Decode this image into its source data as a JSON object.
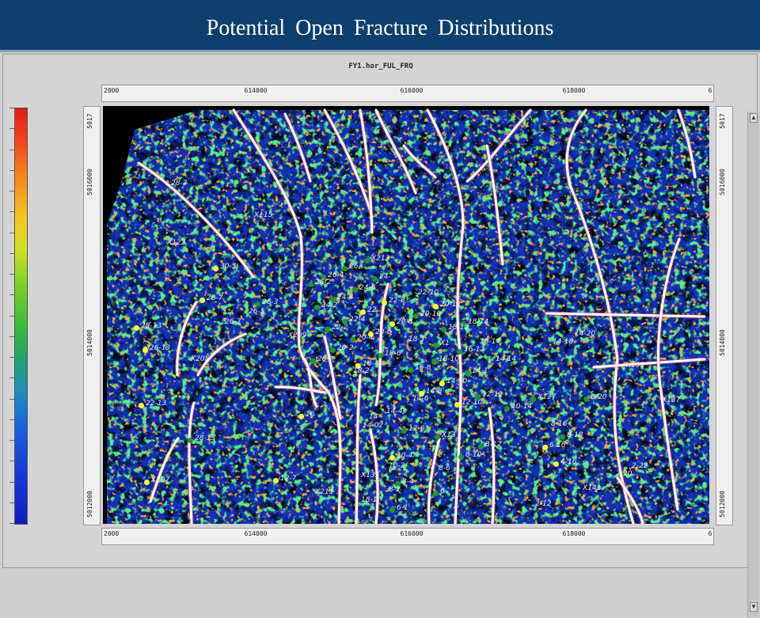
{
  "slide_title": "Potential  Open  Fracture  Distributions",
  "map_title": "FY1.hor_FUL_FRQ",
  "colors": {
    "title_bg": "#0d3f6e",
    "background": "#0a1a9a",
    "yellow_well": "#ffff33",
    "green_well": "#1f9a2a",
    "fracture": "#ffffff"
  },
  "axes": {
    "x_ticks": [
      "2000",
      "614000",
      "616000",
      "618000",
      "6"
    ],
    "y_ticks": [
      "5017",
      "5016000",
      "5014000",
      "5012000"
    ]
  },
  "wells": [
    {
      "label": "X115",
      "color": "none",
      "x": 185,
      "y": 140
    },
    {
      "label": "28-7",
      "color": "none",
      "x": 80,
      "y": 100
    },
    {
      "label": "X122",
      "color": "none",
      "x": 75,
      "y": 175
    },
    {
      "label": "30-5",
      "color": "yellow",
      "x": 142,
      "y": 205
    },
    {
      "label": "28-7",
      "color": "yellow",
      "x": 125,
      "y": 245
    },
    {
      "label": "26-3",
      "color": "green",
      "x": 195,
      "y": 250
    },
    {
      "label": "26-5",
      "color": "none",
      "x": 178,
      "y": 262
    },
    {
      "label": "26-7",
      "color": "none",
      "x": 148,
      "y": 275
    },
    {
      "label": "28-13",
      "color": "yellow",
      "x": 42,
      "y": 280
    },
    {
      "label": "26-13",
      "color": "yellow",
      "x": 53,
      "y": 308
    },
    {
      "label": "X209",
      "color": "none",
      "x": 228,
      "y": 292
    },
    {
      "label": "X205",
      "color": "none",
      "x": 105,
      "y": 322
    },
    {
      "label": "22-13",
      "color": "yellow",
      "x": 48,
      "y": 378
    },
    {
      "label": "20-",
      "color": "green",
      "x": 265,
      "y": 322
    },
    {
      "label": "16",
      "color": "yellow",
      "x": 250,
      "y": 392
    },
    {
      "label": "28-13",
      "color": "green",
      "x": 110,
      "y": 422
    },
    {
      "label": "X207",
      "color": "yellow",
      "x": 55,
      "y": 475
    },
    {
      "label": "12-7",
      "color": "yellow",
      "x": 218,
      "y": 473
    },
    {
      "label": "X211",
      "color": "none",
      "x": 262,
      "y": 490
    },
    {
      "label": "X213",
      "color": "green",
      "x": 333,
      "y": 195
    },
    {
      "label": "26-",
      "color": "green",
      "x": 305,
      "y": 205
    },
    {
      "label": "24-",
      "color": "green",
      "x": 343,
      "y": 218
    },
    {
      "label": "26-4",
      "color": "green",
      "x": 278,
      "y": 216
    },
    {
      "label": "26-2",
      "color": "green",
      "x": 262,
      "y": 225
    },
    {
      "label": "24-6",
      "color": "green",
      "x": 318,
      "y": 232
    },
    {
      "label": "24-4",
      "color": "green",
      "x": 290,
      "y": 244
    },
    {
      "label": "22-8",
      "color": "yellow",
      "x": 355,
      "y": 248
    },
    {
      "label": "24-2",
      "color": "green",
      "x": 270,
      "y": 254
    },
    {
      "label": "22-",
      "color": "yellow",
      "x": 328,
      "y": 260
    },
    {
      "label": "22-4",
      "color": "green",
      "x": 305,
      "y": 272
    },
    {
      "label": "22-2",
      "color": "green",
      "x": 283,
      "y": 282
    },
    {
      "label": "20-6",
      "color": "yellow",
      "x": 338,
      "y": 288
    },
    {
      "label": "20-4",
      "color": "green",
      "x": 315,
      "y": 295
    },
    {
      "label": "22-10",
      "color": "none",
      "x": 392,
      "y": 238
    },
    {
      "label": "20-12",
      "color": "yellow",
      "x": 420,
      "y": 253
    },
    {
      "label": "20-10",
      "color": "green",
      "x": 395,
      "y": 265
    },
    {
      "label": "20-8",
      "color": "yellow",
      "x": 365,
      "y": 275
    },
    {
      "label": "18-14",
      "color": "green",
      "x": 455,
      "y": 275
    },
    {
      "label": "18-15",
      "color": "green",
      "x": 430,
      "y": 282
    },
    {
      "label": "18-3",
      "color": "none",
      "x": 380,
      "y": 297
    },
    {
      "label": "X1",
      "color": "green",
      "x": 420,
      "y": 302
    },
    {
      "label": "16-14",
      "color": "none",
      "x": 470,
      "y": 300
    },
    {
      "label": "16-12",
      "color": "green",
      "x": 450,
      "y": 310
    },
    {
      "label": "20-2",
      "color": "green",
      "x": 290,
      "y": 308
    },
    {
      "label": "18-6",
      "color": "green",
      "x": 350,
      "y": 315
    },
    {
      "label": "16-10",
      "color": "green",
      "x": 418,
      "y": 322
    },
    {
      "label": "18-4",
      "color": "yellow",
      "x": 322,
      "y": 328
    },
    {
      "label": "16-8",
      "color": "green",
      "x": 388,
      "y": 333
    },
    {
      "label": "14-14",
      "color": "none",
      "x": 490,
      "y": 322
    },
    {
      "label": "14-1",
      "color": "green",
      "x": 460,
      "y": 337
    },
    {
      "label": "18-2",
      "color": "none",
      "x": 310,
      "y": 337
    },
    {
      "label": "14-10",
      "color": "yellow",
      "x": 428,
      "y": 350
    },
    {
      "label": "14-8",
      "color": "yellow",
      "x": 402,
      "y": 363
    },
    {
      "label": "14-6",
      "color": "none",
      "x": 385,
      "y": 372
    },
    {
      "label": "12-12",
      "color": "green",
      "x": 473,
      "y": 367
    },
    {
      "label": "12-10",
      "color": "yellow",
      "x": 447,
      "y": 377
    },
    {
      "label": "10-14",
      "color": "green",
      "x": 510,
      "y": 382
    },
    {
      "label": "X137",
      "color": "green",
      "x": 543,
      "y": 370
    },
    {
      "label": "8-20",
      "color": "green",
      "x": 610,
      "y": 370
    },
    {
      "label": "X137",
      "color": "none",
      "x": 700,
      "y": 374
    },
    {
      "label": "14-",
      "color": "none",
      "x": 330,
      "y": 395
    },
    {
      "label": "14-4",
      "color": "none",
      "x": 352,
      "y": 388
    },
    {
      "label": "14-02",
      "color": "none",
      "x": 322,
      "y": 406
    },
    {
      "label": "12-6",
      "color": "green",
      "x": 380,
      "y": 410
    },
    {
      "label": "X13",
      "color": "green",
      "x": 422,
      "y": 418
    },
    {
      "label": "8-16",
      "color": "none",
      "x": 560,
      "y": 404
    },
    {
      "label": "8-18",
      "color": "green",
      "x": 580,
      "y": 418
    },
    {
      "label": "6-16",
      "color": "yellow",
      "x": 558,
      "y": 431
    },
    {
      "label": "8-12",
      "color": "green",
      "x": 477,
      "y": 430
    },
    {
      "label": "8-10",
      "color": "green",
      "x": 452,
      "y": 443
    },
    {
      "label": "10-4",
      "color": "yellow",
      "x": 365,
      "y": 444
    },
    {
      "label": "4-16",
      "color": "yellow",
      "x": 572,
      "y": 452
    },
    {
      "label": "10-2",
      "color": "none",
      "x": 355,
      "y": 457
    },
    {
      "label": "8-6",
      "color": "none",
      "x": 418,
      "y": 460
    },
    {
      "label": "2-22",
      "color": "none",
      "x": 662,
      "y": 457
    },
    {
      "label": "2-20",
      "color": "none",
      "x": 642,
      "y": 467
    },
    {
      "label": "X135",
      "color": "none",
      "x": 320,
      "y": 469
    },
    {
      "label": "8-4",
      "color": "green",
      "x": 372,
      "y": 477
    },
    {
      "label": "8-2",
      "color": "none",
      "x": 355,
      "y": 487
    },
    {
      "label": "6-",
      "color": "green",
      "x": 420,
      "y": 489
    },
    {
      "label": "X141",
      "color": "none",
      "x": 600,
      "y": 485
    },
    {
      "label": "18-1",
      "color": "none",
      "x": 320,
      "y": 500
    },
    {
      "label": "6-1",
      "color": "green",
      "x": 365,
      "y": 510
    },
    {
      "label": "2-12",
      "color": "none",
      "x": 540,
      "y": 505
    },
    {
      "label": "14-18",
      "color": "none",
      "x": 562,
      "y": 300
    },
    {
      "label": "14-20",
      "color": "none",
      "x": 590,
      "y": 290
    },
    {
      "label": "X193",
      "color": "none",
      "x": 655,
      "y": 330
    }
  ],
  "faults": [
    "M45,72 C90,100 150,160 190,216",
    "M165,5 C200,60 240,120 250,165 C255,220 245,260 248,305 C255,330 270,345 285,362 C300,390 300,420 300,450 L298,528",
    "M230,10 C245,40 255,70 262,95",
    "M280,5 C300,40 325,90 340,140",
    "M325,5 C335,60 338,110 340,160",
    "M345,5 C360,40 380,70 395,110",
    "M380,50 C395,70 410,80 420,90",
    "M410,5 C440,60 455,110 455,150 C450,200 445,250 450,300 C455,350 450,420 445,528",
    "M460,95 C480,80 510,40 540,5",
    "M485,50 C495,100 500,150 505,200",
    "M610,5 C590,30 580,60 590,100 C615,160 640,240 650,320 C640,400 650,460 670,528",
    "M727,5 C740,40 745,70 748,90",
    "M360,225 C345,280 355,330 345,378",
    "M255,320 C265,340 260,360 270,380",
    "M218,355 C250,355 265,360 280,362",
    "M280,292 C290,330 295,370 300,395",
    "M325,340 C320,400 322,460 320,528",
    "M338,410 C345,440 350,480 345,528",
    "M425,420 C415,460 410,490 412,528",
    "M118,248 C100,275 92,310 94,340",
    "M115,375 C105,410 110,470 112,528",
    "M180,288 C150,300 130,320 120,340",
    "M95,420 C80,440 70,470 60,500",
    "M560,262 L760,266",
    "M620,330 L760,320",
    "M728,168 C708,220 695,300 705,360 C712,420 720,470 726,510",
    "M650,470 C665,490 678,510 682,528",
    "M488,382 C495,430 495,480 492,528"
  ]
}
